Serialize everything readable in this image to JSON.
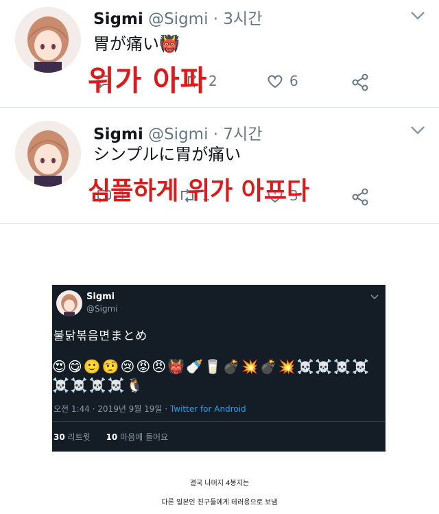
{
  "tweets": [
    {
      "name": "Sigmi",
      "handle": "@Sigmi",
      "dot": "·",
      "time": "3시간",
      "body": "胃が痛い",
      "body_emoji": "👹",
      "overlay": "위가 아파",
      "actions": {
        "reply": "",
        "retweet": "2",
        "like": "6"
      }
    },
    {
      "name": "Sigmi",
      "handle": "@Sigmi",
      "dot": "·",
      "time": "7시간",
      "body": "シンプルに胃が痛い",
      "overlay": "심플하게 위가 아프다",
      "actions": {
        "reply": "1",
        "retweet": "1",
        "like": "3"
      }
    }
  ],
  "embedded": {
    "name": "Sigmi",
    "handle": "@Sigmi",
    "text": "불닭볶음면まとめ",
    "emoji_row1": [
      "😍",
      "😋",
      "🙂",
      "🤨",
      "😢",
      "😡",
      "😠",
      "👹",
      "🍼",
      "🥛",
      "💣",
      "💥",
      "💣",
      "💥",
      "☠️",
      "☠️",
      "☠️",
      "☠️"
    ],
    "emoji_row2": [
      "☠️",
      "☠️",
      "☠️",
      "☠️",
      "🐧"
    ],
    "meta_time": "오전 1:44 · 2019년 9월 19일 · ",
    "meta_client": "Twitter for Android",
    "retweets_count": "30",
    "retweets_label": "리트윗",
    "likes_count": "10",
    "likes_label": "마음에 들어요"
  },
  "captions": {
    "line1": "결국 나머지 4봉지는",
    "line2": "다른 일본인 친구들에게 테러용으로 보냄"
  },
  "colors": {
    "overlay_red": "#e01818",
    "dark_bg": "#141d26",
    "link_blue": "#1da1f2",
    "muted": "#657786"
  }
}
